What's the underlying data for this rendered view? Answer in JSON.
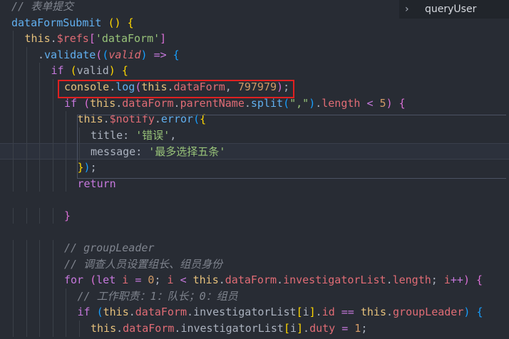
{
  "outline": {
    "chevron_glyph": "›",
    "symbol_name": "queryUser"
  },
  "code_lines": [
    {
      "indent": 0,
      "tokens": [
        [
          "c-cmt",
          "// 表单提交"
        ]
      ]
    },
    {
      "indent": 0,
      "tokens": [
        [
          "c-fn",
          "dataFormSubmit"
        ],
        [
          "c-punc",
          " "
        ],
        [
          "c-bracket1",
          "()"
        ],
        [
          "c-punc",
          " "
        ],
        [
          "c-bracket1",
          "{"
        ]
      ]
    },
    {
      "indent": 1,
      "tokens": [
        [
          "c-this",
          "this"
        ],
        [
          "c-punc",
          "."
        ],
        [
          "c-prop",
          "$refs"
        ],
        [
          "c-bracket2",
          "["
        ],
        [
          "c-str",
          "'dataForm'"
        ],
        [
          "c-bracket2",
          "]"
        ]
      ]
    },
    {
      "indent": 2,
      "tokens": [
        [
          "c-punc",
          "."
        ],
        [
          "c-fn",
          "validate"
        ],
        [
          "c-bracket2",
          "("
        ],
        [
          "c-bracket3",
          "("
        ],
        [
          "c-param",
          "valid"
        ],
        [
          "c-bracket3",
          ")"
        ],
        [
          "c-punc",
          " "
        ],
        [
          "c-kw",
          "=>"
        ],
        [
          "c-punc",
          " "
        ],
        [
          "c-bracket3",
          "{"
        ]
      ]
    },
    {
      "indent": 3,
      "tokens": [
        [
          "c-kw",
          "if"
        ],
        [
          "c-punc",
          " "
        ],
        [
          "c-bracket1",
          "("
        ],
        [
          "c-punc",
          "valid"
        ],
        [
          "c-bracket1",
          ")"
        ],
        [
          "c-punc",
          " "
        ],
        [
          "c-bracket1",
          "{"
        ]
      ]
    },
    {
      "indent": 4,
      "tokens": [
        [
          "c-this",
          "console"
        ],
        [
          "c-punc",
          "."
        ],
        [
          "c-fn",
          "log"
        ],
        [
          "c-bracket2",
          "("
        ],
        [
          "c-this",
          "this"
        ],
        [
          "c-punc",
          "."
        ],
        [
          "c-prop",
          "dataForm"
        ],
        [
          "c-punc",
          ", "
        ],
        [
          "c-num",
          "797979"
        ],
        [
          "c-bracket2",
          ")"
        ],
        [
          "c-punc",
          ";"
        ]
      ]
    },
    {
      "indent": 4,
      "tokens": [
        [
          "c-kw",
          "if"
        ],
        [
          "c-punc",
          " "
        ],
        [
          "c-bracket2",
          "("
        ],
        [
          "c-this",
          "this"
        ],
        [
          "c-punc",
          "."
        ],
        [
          "c-prop",
          "dataForm"
        ],
        [
          "c-punc",
          "."
        ],
        [
          "c-prop",
          "parentName"
        ],
        [
          "c-punc",
          "."
        ],
        [
          "c-fn",
          "split"
        ],
        [
          "c-bracket3",
          "("
        ],
        [
          "c-str",
          "\",\""
        ],
        [
          "c-bracket3",
          ")"
        ],
        [
          "c-punc",
          "."
        ],
        [
          "c-prop",
          "length"
        ],
        [
          "c-punc",
          " "
        ],
        [
          "c-kw",
          "<"
        ],
        [
          "c-punc",
          " "
        ],
        [
          "c-num",
          "5"
        ],
        [
          "c-bracket2",
          ")"
        ],
        [
          "c-punc",
          " "
        ],
        [
          "c-bracket2",
          "{"
        ]
      ]
    },
    {
      "indent": 5,
      "tokens": [
        [
          "c-this",
          "this"
        ],
        [
          "c-punc",
          "."
        ],
        [
          "c-prop",
          "$notify"
        ],
        [
          "c-punc",
          "."
        ],
        [
          "c-fn",
          "error"
        ],
        [
          "c-bracket3",
          "("
        ],
        [
          "c-bracket1",
          "{"
        ]
      ]
    },
    {
      "indent": 6,
      "tokens": [
        [
          "c-punc",
          "title: "
        ],
        [
          "c-str",
          "'错误'"
        ],
        [
          "c-punc",
          ","
        ]
      ]
    },
    {
      "indent": 6,
      "tokens": [
        [
          "c-punc",
          "message: "
        ],
        [
          "c-str",
          "'最多选择五条'"
        ]
      ],
      "active": true
    },
    {
      "indent": 5,
      "tokens": [
        [
          "c-bracket1",
          "}"
        ],
        [
          "c-bracket3",
          ")"
        ],
        [
          "c-punc",
          ";"
        ]
      ]
    },
    {
      "indent": 5,
      "tokens": [
        [
          "c-kw",
          "return"
        ]
      ]
    },
    {
      "indent": 0,
      "tokens": []
    },
    {
      "indent": 4,
      "tokens": [
        [
          "c-bracket2",
          "}"
        ]
      ]
    },
    {
      "indent": 0,
      "tokens": []
    },
    {
      "indent": 4,
      "tokens": [
        [
          "c-cmt",
          "// groupLeader"
        ]
      ]
    },
    {
      "indent": 4,
      "tokens": [
        [
          "c-cmt",
          "// 调查人员设置组长、组员身份"
        ]
      ]
    },
    {
      "indent": 4,
      "tokens": [
        [
          "c-kw",
          "for"
        ],
        [
          "c-punc",
          " "
        ],
        [
          "c-bracket2",
          "("
        ],
        [
          "c-kw",
          "let"
        ],
        [
          "c-punc",
          " "
        ],
        [
          "c-var",
          "i"
        ],
        [
          "c-punc",
          " "
        ],
        [
          "c-kw",
          "="
        ],
        [
          "c-punc",
          " "
        ],
        [
          "c-num",
          "0"
        ],
        [
          "c-punc",
          "; "
        ],
        [
          "c-var",
          "i"
        ],
        [
          "c-punc",
          " "
        ],
        [
          "c-kw",
          "<"
        ],
        [
          "c-punc",
          " "
        ],
        [
          "c-this",
          "this"
        ],
        [
          "c-punc",
          "."
        ],
        [
          "c-prop",
          "dataForm"
        ],
        [
          "c-punc",
          "."
        ],
        [
          "c-prop",
          "investigatorList"
        ],
        [
          "c-punc",
          "."
        ],
        [
          "c-prop",
          "length"
        ],
        [
          "c-punc",
          "; "
        ],
        [
          "c-var",
          "i"
        ],
        [
          "c-kw",
          "++"
        ],
        [
          "c-bracket2",
          ")"
        ],
        [
          "c-punc",
          " "
        ],
        [
          "c-bracket2",
          "{"
        ]
      ]
    },
    {
      "indent": 5,
      "tokens": [
        [
          "c-cmt",
          "// 工作职责：1：队长；0：组员"
        ]
      ]
    },
    {
      "indent": 5,
      "tokens": [
        [
          "c-kw",
          "if"
        ],
        [
          "c-punc",
          " "
        ],
        [
          "c-bracket3",
          "("
        ],
        [
          "c-this",
          "this"
        ],
        [
          "c-punc",
          "."
        ],
        [
          "c-prop",
          "dataForm"
        ],
        [
          "c-punc",
          "."
        ],
        [
          "c-punc",
          "investigatorList"
        ],
        [
          "c-bracket1",
          "["
        ],
        [
          "c-punc",
          "i"
        ],
        [
          "c-bracket1",
          "]"
        ],
        [
          "c-punc",
          "."
        ],
        [
          "c-prop",
          "id"
        ],
        [
          "c-punc",
          " "
        ],
        [
          "c-kw",
          "=="
        ],
        [
          "c-punc",
          " "
        ],
        [
          "c-this",
          "this"
        ],
        [
          "c-punc",
          "."
        ],
        [
          "c-prop",
          "groupLeader"
        ],
        [
          "c-bracket3",
          ")"
        ],
        [
          "c-punc",
          " "
        ],
        [
          "c-bracket3",
          "{"
        ]
      ]
    },
    {
      "indent": 6,
      "tokens": [
        [
          "c-this",
          "this"
        ],
        [
          "c-punc",
          "."
        ],
        [
          "c-prop",
          "dataForm"
        ],
        [
          "c-punc",
          "."
        ],
        [
          "c-punc",
          "investigatorList"
        ],
        [
          "c-bracket1",
          "["
        ],
        [
          "c-punc",
          "i"
        ],
        [
          "c-bracket1",
          "]"
        ],
        [
          "c-punc",
          "."
        ],
        [
          "c-prop",
          "duty"
        ],
        [
          "c-punc",
          " "
        ],
        [
          "c-kw",
          "="
        ],
        [
          "c-punc",
          " "
        ],
        [
          "c-num",
          "1"
        ],
        [
          "c-punc",
          ";"
        ]
      ]
    }
  ]
}
